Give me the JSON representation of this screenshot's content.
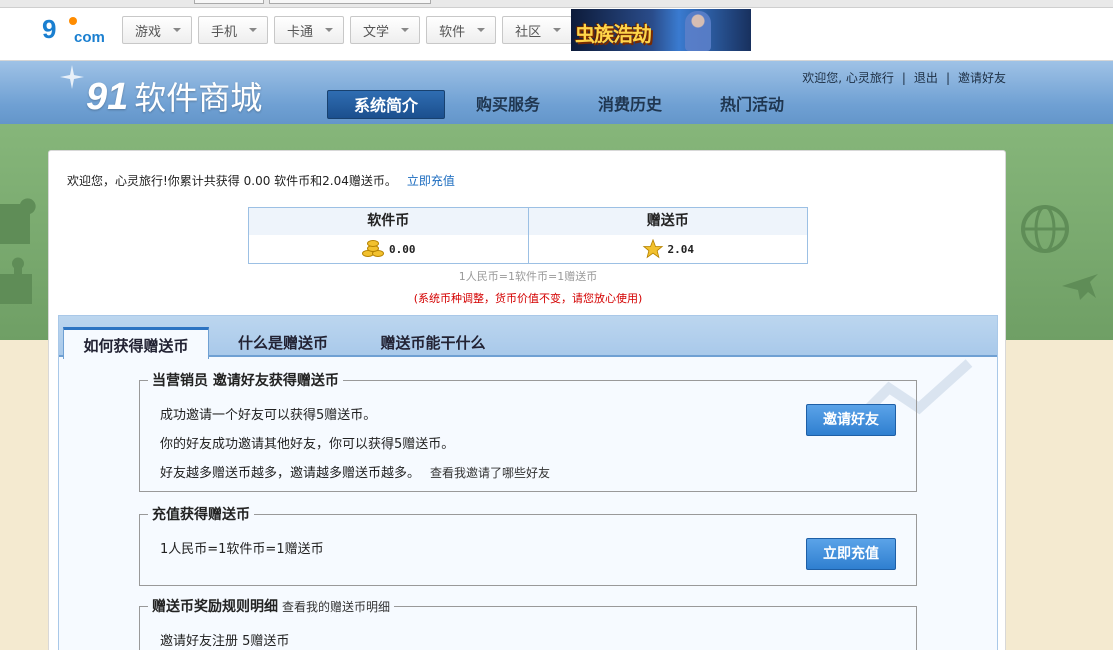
{
  "portal": {
    "logo_text": "9",
    "logo_suffix": "com",
    "nav": [
      {
        "label": "游戏"
      },
      {
        "label": "手机"
      },
      {
        "label": "卡通"
      },
      {
        "label": "文学"
      },
      {
        "label": "软件"
      },
      {
        "label": "社区"
      }
    ],
    "ad_text": "虫族浩劫"
  },
  "header": {
    "site_num": "91",
    "site_name": "软件商城",
    "nav": [
      {
        "label": "系统简介",
        "active": true
      },
      {
        "label": "购买服务"
      },
      {
        "label": "消费历史"
      },
      {
        "label": "热门活动"
      }
    ],
    "user_links": {
      "welcome": "欢迎您, 心灵旅行",
      "logout": "退出",
      "invite": "邀请好友",
      "separator": "|"
    }
  },
  "summary": {
    "welcome_text": "欢迎您，心灵旅行!你累计共获得 0.00 软件币和2.04赠送币。",
    "recharge_link": "立即充值",
    "software_coin_label": "软件币",
    "software_coin_value": "0.00",
    "gift_coin_label": "赠送币",
    "gift_coin_value": "2.04",
    "rate_note": "1人民币=1软件币=1赠送币",
    "adjust_note": "(系统币种调整，货币价值不变，请您放心使用)"
  },
  "tabs": [
    {
      "label": "如何获得赠送币",
      "active": true
    },
    {
      "label": "什么是赠送币"
    },
    {
      "label": "赠送币能干什么"
    }
  ],
  "sections": {
    "invite": {
      "title": "当营销员 邀请好友获得赠送币",
      "line1": "成功邀请一个好友可以获得5赠送币。",
      "line2": "你的好友成功邀请其他好友，你可以获得5赠送币。",
      "line3": "好友越多赠送币越多，邀请越多赠送币越多。",
      "line3_link": "查看我邀请了哪些好友",
      "button": "邀请好友"
    },
    "recharge": {
      "title": "充值获得赠送币",
      "line1": "1人民币=1软件币=1赠送币",
      "button": "立即充值"
    },
    "rules": {
      "title": "赠送币奖励规则明细",
      "title_link": "查看我的赠送币明细",
      "line1": "邀请好友注册  5赠送币"
    }
  },
  "colors": {
    "header_blue": "#6fa0d3",
    "active_nav": "#1b4f8e",
    "button_blue": "#2f7fd0",
    "link_blue": "#1a6bbf",
    "notice_red": "#d40000",
    "green_band": "#7aab6f"
  }
}
